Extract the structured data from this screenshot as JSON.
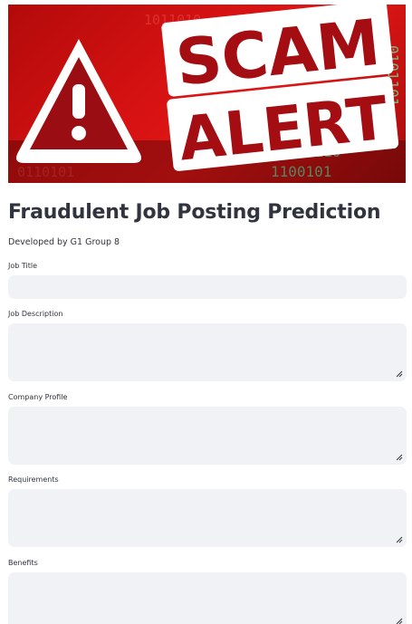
{
  "banner": {
    "word1": "SCAM",
    "word2": "ALERT",
    "binary_rows": [
      "1011010",
      "0110101",
      "1010101",
      "0010110",
      "1100101",
      "0101101"
    ]
  },
  "header": {
    "title": "Fraudulent Job Posting Prediction",
    "subtitle": "Developed by G1 Group 8"
  },
  "form": {
    "job_title_label": "Job Title",
    "job_title_value": "",
    "job_description_label": "Job Description",
    "job_description_value": "",
    "company_profile_label": "Company Profile",
    "company_profile_value": "",
    "requirements_label": "Requirements",
    "requirements_value": "",
    "benefits_label": "Benefits",
    "benefits_value": ""
  },
  "colors": {
    "banner_red": "#d61212",
    "field_bg": "#f0f2f6",
    "text": "#31333f",
    "binary_green": "#6fd39a"
  }
}
